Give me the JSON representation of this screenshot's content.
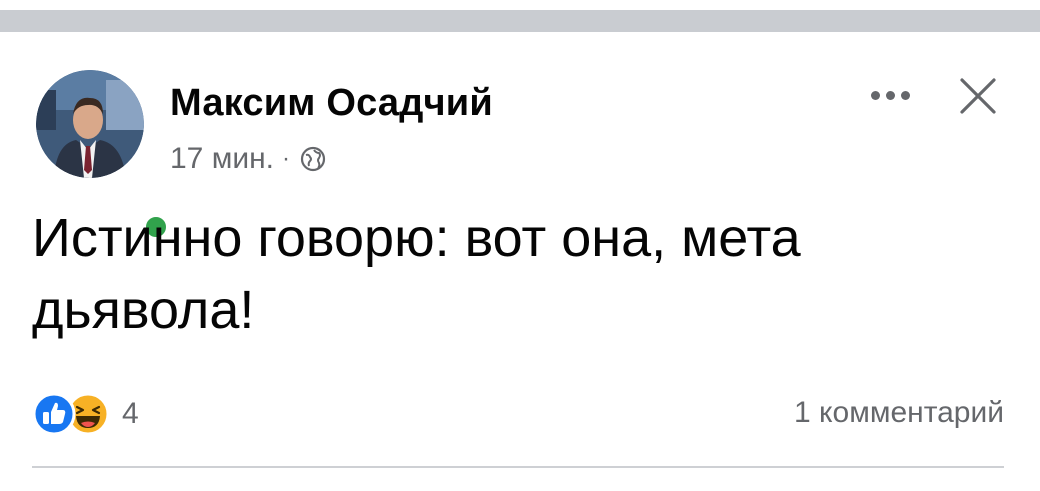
{
  "post": {
    "author": "Максим Осадчий",
    "time": "17 мин.",
    "separator": "·",
    "privacy_icon": "globe-icon",
    "text": "Истинно говорю: вот она, мета дьявола!",
    "reactions": {
      "icons": [
        "like-icon",
        "haha-icon"
      ],
      "count": "4"
    },
    "comments": "1 комментарий"
  },
  "colors": {
    "online": "#31a24c",
    "like": "#1877f2",
    "haha": "#f7b125",
    "secondary_text": "#65676b",
    "primary_text": "#050505"
  }
}
